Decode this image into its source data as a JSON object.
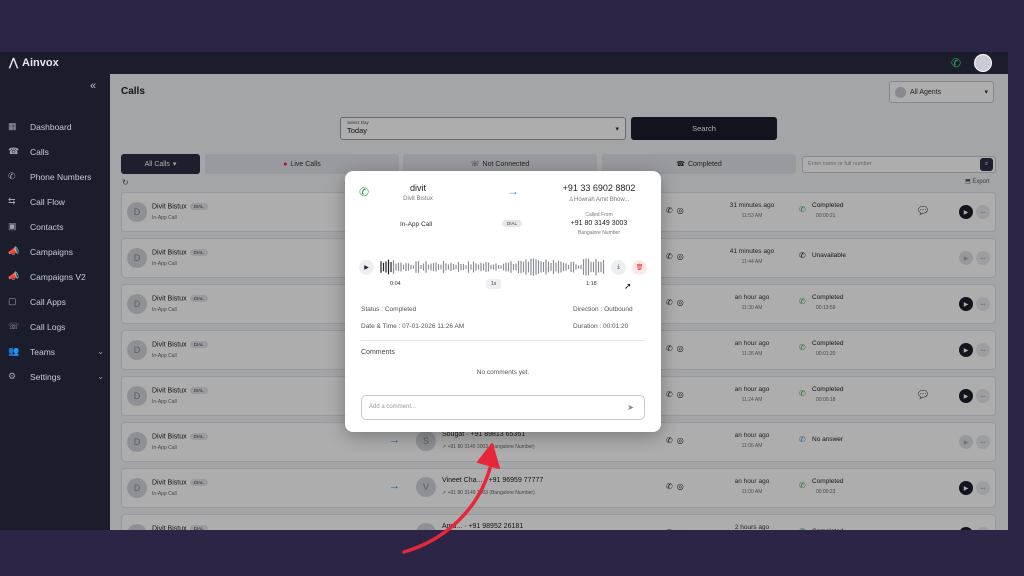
{
  "app": {
    "brand": "Ainvox"
  },
  "sidebar": {
    "items": [
      {
        "icon": "dashboard-icon",
        "label": "Dashboard"
      },
      {
        "icon": "calls-icon",
        "label": "Calls"
      },
      {
        "icon": "phone-icon",
        "label": "Phone Numbers"
      },
      {
        "icon": "call-flow-icon",
        "label": "Call Flow"
      },
      {
        "icon": "contacts-icon",
        "label": "Contacts"
      },
      {
        "icon": "campaigns-icon",
        "label": "Campaigns"
      },
      {
        "icon": "campaigns-v2-icon",
        "label": "Campaigns V2"
      },
      {
        "icon": "call-apps-icon",
        "label": "Call Apps"
      },
      {
        "icon": "call-logs-icon",
        "label": "Call Logs"
      },
      {
        "icon": "teams-icon",
        "label": "Teams"
      },
      {
        "icon": "settings-icon",
        "label": "Settings"
      }
    ]
  },
  "header": {
    "title": "Calls",
    "agents_label": "All Agents"
  },
  "filter": {
    "day_label": "Select Day",
    "day_value": "Today",
    "search_label": "Search"
  },
  "tabs": {
    "all": "All Calls",
    "live": "Live Calls",
    "not_connected": "Not Connected",
    "completed": "Completed"
  },
  "number_search": {
    "placeholder": "Enter name or full number"
  },
  "export_label": "Export",
  "rows": [
    {
      "initial": "D",
      "name": "Divit Bistux",
      "badge": "DIAL",
      "sub": "In-App Call",
      "contact_initial": "",
      "contact": "",
      "from": "",
      "time": "31 minutes ago",
      "clock": "11:53 AM",
      "status": "Completed",
      "duration": "00:00:21",
      "has_comment": true,
      "play_enabled": true
    },
    {
      "initial": "D",
      "name": "Divit Bistux",
      "badge": "DIAL",
      "sub": "In-App Call",
      "contact_initial": "",
      "contact": "",
      "from": "",
      "time": "41 minutes ago",
      "clock": "11:44 AM",
      "status": "Unavailable",
      "duration": "",
      "has_comment": false,
      "play_enabled": false
    },
    {
      "initial": "D",
      "name": "Divit Bistux",
      "badge": "DIAL",
      "sub": "In-App Call",
      "contact_initial": "",
      "contact": "",
      "from": "",
      "time": "an hour ago",
      "clock": "11:30 AM",
      "status": "Completed",
      "duration": "00:13:59",
      "has_comment": false,
      "play_enabled": true
    },
    {
      "initial": "D",
      "name": "Divit Bistux",
      "badge": "DIAL",
      "sub": "In-App Call",
      "contact_initial": "",
      "contact": "",
      "from": "",
      "time": "an hour ago",
      "clock": "11:26 AM",
      "status": "Completed",
      "duration": "00:01:20",
      "has_comment": false,
      "play_enabled": true
    },
    {
      "initial": "D",
      "name": "Divit Bistux",
      "badge": "DIAL",
      "sub": "In-App Call",
      "contact_initial": "",
      "contact": "",
      "from": "",
      "time": "an hour ago",
      "clock": "11:24 AM",
      "status": "Completed",
      "duration": "00:00:18",
      "has_comment": true,
      "play_enabled": true
    },
    {
      "initial": "D",
      "name": "Divit Bistux",
      "badge": "DIAL",
      "sub": "In-App Call",
      "contact_initial": "S",
      "contact": "Sougat · +91 89813 65361",
      "from": "↗ +91 80 3149 3003 (Bangalore Number)",
      "time": "an hour ago",
      "clock": "11:06 AM",
      "status": "No answer",
      "duration": "",
      "has_comment": false,
      "play_enabled": false
    },
    {
      "initial": "D",
      "name": "Divit Bistux",
      "badge": "DIAL",
      "sub": "In-App Call",
      "contact_initial": "V",
      "contact": "Vineet Cha... · +91 96959 77777",
      "from": "↗ +91 80 3149 3003 (Bangalore Number)",
      "time": "an hour ago",
      "clock": "11:00 AM",
      "status": "Completed",
      "duration": "00:00:23",
      "has_comment": false,
      "play_enabled": true
    },
    {
      "initial": "D",
      "name": "Divit Bistux",
      "badge": "DIAL",
      "sub": "In-App Call",
      "contact_initial": "A",
      "contact": "Amu... · +91 98952 26181",
      "from": "",
      "time": "2 hours ago",
      "clock": "",
      "status": "Completed",
      "duration": "",
      "has_comment": false,
      "play_enabled": true
    }
  ],
  "modal": {
    "agent_name": "divit",
    "agent_sub": "Divit Bistux",
    "to_number": "+91 33 6902 8802",
    "to_name": "Howrah Amit Bhow...",
    "call_type": "In-App Call",
    "badge": "DIAL",
    "called_from_label": "Called From",
    "called_from_number": "+91 80 3149 3003",
    "called_from_sub": "Bangalore Number",
    "time_current": "0:04",
    "speed": "1x",
    "time_total": "1:18",
    "status": "Status : Completed",
    "direction": "Direction : Outbound",
    "datetime": "Date & Time : 07-01-2026 11:26 AM",
    "duration": "Duration : 00:01:20",
    "comments_title": "Comments",
    "no_comments": "No comments yet.",
    "comment_placeholder": "Add a comment..."
  },
  "colors": {
    "sidebar": "#1b1d2c",
    "accent_green": "#2ea44f",
    "accent_blue": "#3b8ad9",
    "annotation_red": "#e8263a",
    "backdrop": "#2c2545"
  }
}
